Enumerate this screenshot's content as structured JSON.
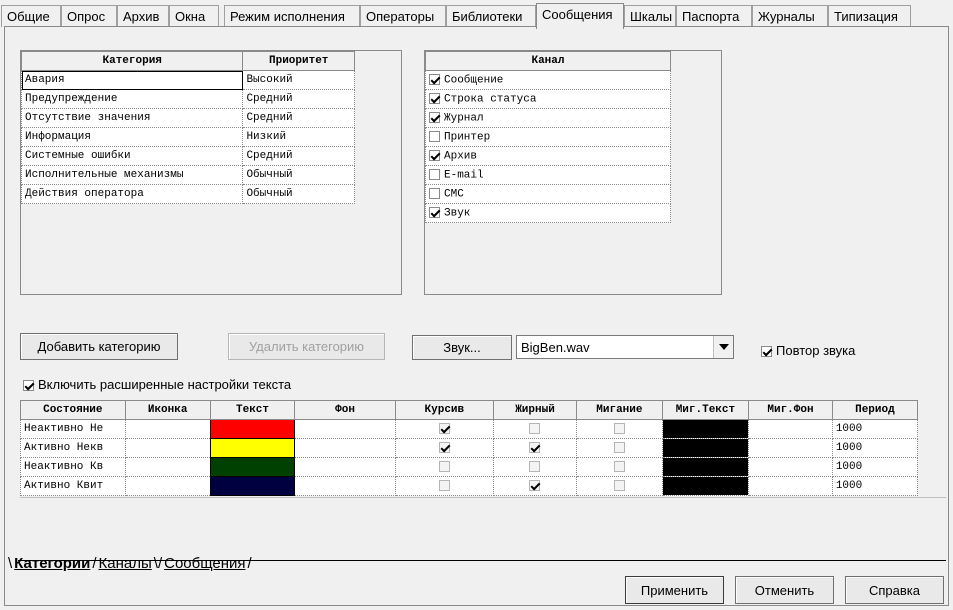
{
  "tabs": [
    "Общие",
    "Опрос",
    "Архив",
    "Окна",
    "Режим исполнения",
    "Операторы",
    "Библиотеки",
    "Сообщения",
    "Шкалы",
    "Паспорта",
    "Журналы",
    "Типизация"
  ],
  "active_tab": 7,
  "categories": {
    "headers": {
      "category": "Категория",
      "priority": "Приоритет"
    },
    "rows": [
      {
        "name": "Авария",
        "priority": "Высокий"
      },
      {
        "name": "Предупреждение",
        "priority": "Средний"
      },
      {
        "name": "Отсутствие значения",
        "priority": "Средний"
      },
      {
        "name": "Информация",
        "priority": "Низкий"
      },
      {
        "name": "Системные ошибки",
        "priority": "Средний"
      },
      {
        "name": "Исполнительные механизмы",
        "priority": "Обычный"
      },
      {
        "name": "Действия оператора",
        "priority": "Обычный"
      }
    ]
  },
  "channels": {
    "header": "Канал",
    "rows": [
      {
        "name": "Сообщение",
        "checked": true
      },
      {
        "name": "Строка статуса",
        "checked": true
      },
      {
        "name": "Журнал",
        "checked": true
      },
      {
        "name": "Принтер",
        "checked": false
      },
      {
        "name": "Архив",
        "checked": true
      },
      {
        "name": "E-mail",
        "checked": false
      },
      {
        "name": "СМС",
        "checked": false
      },
      {
        "name": "Звук",
        "checked": true
      }
    ]
  },
  "buttons": {
    "add_category": "Добавить категорию",
    "delete_category": "Удалить категорию",
    "sound": "Звук...",
    "apply": "Применить",
    "cancel": "Отменить",
    "help": "Справка"
  },
  "sound_file": "BigBen.wav",
  "repeat_sound": {
    "label": "Повтор звука",
    "checked": true
  },
  "extended_text": {
    "label": "Включить расширенные настройки текста",
    "checked": true
  },
  "states": {
    "headers": [
      "Состояние",
      "Иконка",
      "Текст",
      "Фон",
      "Курсив",
      "Жирный",
      "Мигание",
      "Миг.Текст",
      "Миг.Фон",
      "Период"
    ],
    "rows": [
      {
        "name": "Неактивно Не",
        "text_color": "#ff0000",
        "italic": true,
        "bold": false,
        "blink": false,
        "blink_text_color": "#000000",
        "period": "1000"
      },
      {
        "name": "Активно Некв",
        "text_color": "#ffff00",
        "italic": true,
        "bold": true,
        "blink": false,
        "blink_text_color": "#000000",
        "period": "1000"
      },
      {
        "name": "Неактивно Кв",
        "text_color": "#004000",
        "italic": false,
        "bold": false,
        "blink": false,
        "blink_text_color": "#000000",
        "period": "1000"
      },
      {
        "name": "Активно Квит",
        "text_color": "#000040",
        "italic": false,
        "bold": true,
        "blink": false,
        "blink_text_color": "#000000",
        "period": "1000"
      }
    ]
  },
  "bottom_tabs": [
    "Категории",
    "Каналы",
    "Сообщения"
  ]
}
